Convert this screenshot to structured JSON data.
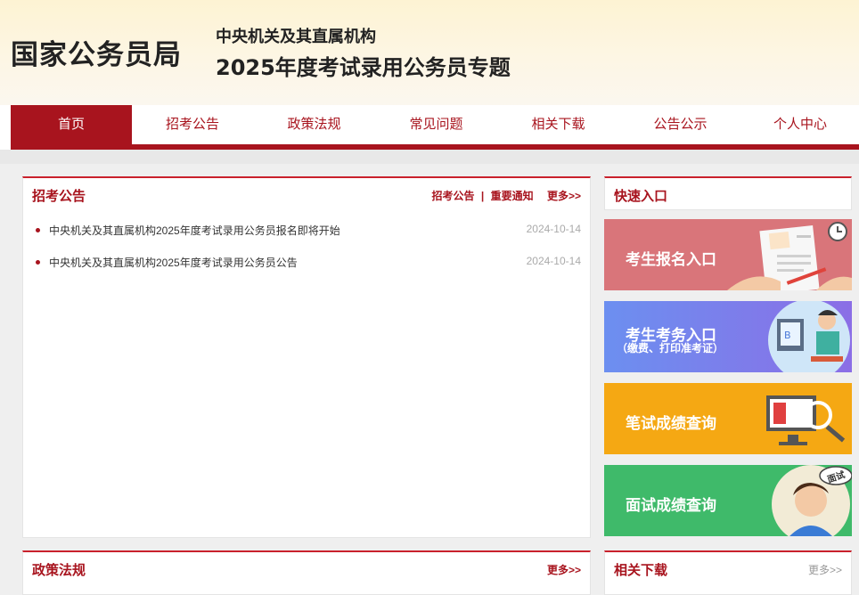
{
  "header": {
    "logo": "国家公务员局",
    "subtitle_line1": "中央机关及其直属机构",
    "subtitle_line2": "2025年度考试录用公务员专题"
  },
  "nav": {
    "items": [
      "首页",
      "招考公告",
      "政策法规",
      "常见问题",
      "相关下载",
      "公告公示",
      "个人中心"
    ],
    "active": "首页"
  },
  "announcements": {
    "title": "招考公告",
    "link1": "招考公告",
    "separator": "|",
    "link2": "重要通知",
    "more": "更多>>",
    "items": [
      {
        "title": "中央机关及其直属机构2025年度考试录用公务员报名即将开始",
        "date": "2024-10-14"
      },
      {
        "title": "中央机关及其直属机构2025年度考试录用公务员公告",
        "date": "2024-10-14"
      }
    ]
  },
  "quick": {
    "title": "快速入口",
    "tiles": [
      {
        "label": "考生报名入口",
        "sub": "",
        "color": "#d9757a"
      },
      {
        "label": "考生考务入口",
        "sub": "（缴费、打印准考证）",
        "color": "#7b76e6"
      },
      {
        "label": "笔试成绩查询",
        "sub": "",
        "color": "#f5a813"
      },
      {
        "label": "面试成绩查询",
        "sub": "",
        "color": "#3fba6a",
        "badge": "面试"
      }
    ]
  },
  "policy": {
    "title": "政策法规",
    "more": "更多>>"
  },
  "downloads": {
    "title": "相关下载",
    "more": "更多>>"
  },
  "colors": {
    "brand": "#a8141e",
    "accent": "#c9212c"
  }
}
